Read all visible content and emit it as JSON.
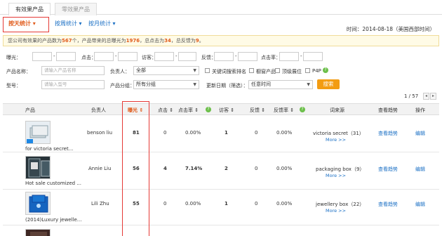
{
  "tabs": [
    "有效果产品",
    "零效果产品"
  ],
  "subnav": {
    "items": [
      "按天统计",
      "按周统计",
      "按月统计"
    ],
    "time_label": "时间：2014-08-18（美国西部时间）"
  },
  "notice": {
    "part1": "您公司有效果的产品数为",
    "count": "567",
    "part2": "个，产品带来的总曝光为",
    "exposure": "1976",
    "part3": "，总点击为",
    "clicks": "34",
    "part4": "，总反馈为",
    "feedback": "9",
    "part5": "。"
  },
  "filters": {
    "row1": [
      "曝光：",
      "点击：",
      "访客：",
      "反馈：",
      "点击率："
    ],
    "product_name_label": "产品名称：",
    "product_name_placeholder": "请输入产品名称",
    "owner_label": "负责人：",
    "owner_value": "全部",
    "cb1": "关键词搜索排名",
    "cb2": "橱窗产品",
    "cb3": "顶级展位",
    "cb4": "P4P",
    "model_label": "型号：",
    "model_placeholder": "请输入型号",
    "group_label": "产品分组：",
    "group_value": "所有分组",
    "date_label": "更新日期（筛选）：",
    "date_value": "任意时间",
    "search_button": "搜索"
  },
  "pager": {
    "text": "1 / 57"
  },
  "table": {
    "headers": [
      "产品",
      "负责人",
      "曝光",
      "点击",
      "点击率",
      "访客",
      "反馈",
      "反馈率",
      "词来源",
      "查看趋势",
      "操作"
    ],
    "rows": [
      {
        "name": "for victoria secret...",
        "owner": "benson liu",
        "exposure": "81",
        "clicks": "0",
        "ctr": "0.00%",
        "visitors": "1",
        "feedback": "0",
        "fbr": "0.00%",
        "source": "victoria secret（31）",
        "more": "More >>",
        "trend": "查看趋势",
        "edit": "编辑"
      },
      {
        "name": "Hot sale customized ...",
        "owner": "Annie Liu",
        "exposure": "56",
        "clicks": "4",
        "ctr": "7.14%",
        "visitors": "2",
        "feedback": "0",
        "fbr": "0.00%",
        "source": "packaging box（9）",
        "more": "More >>",
        "trend": "查看趋势",
        "edit": "编辑"
      },
      {
        "name": "(2014)Luxury jewelle...",
        "owner": "Lili Zhu",
        "exposure": "55",
        "clicks": "0",
        "ctr": "0.00%",
        "visitors": "1",
        "feedback": "0",
        "fbr": "0.00%",
        "source": "jewellery box（22）",
        "more": "More >>",
        "trend": "查看趋势",
        "edit": "编辑"
      }
    ]
  }
}
